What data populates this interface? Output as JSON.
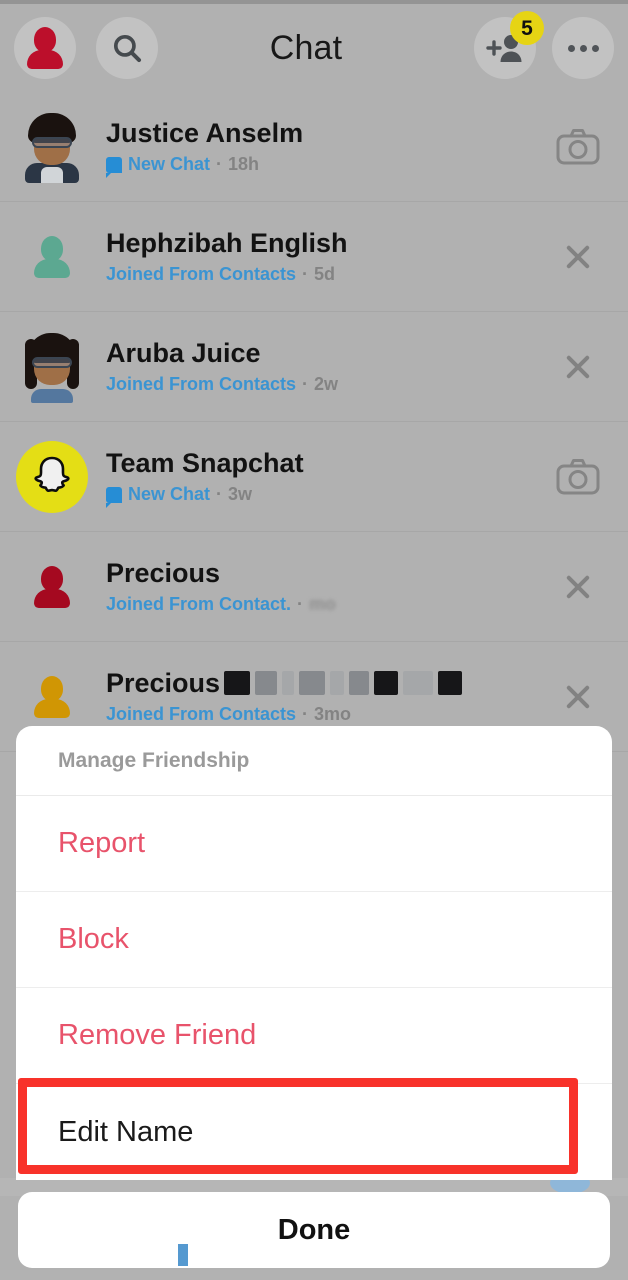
{
  "colors": {
    "background": "#bdbdbd",
    "accent_blue": "#3f9ee0",
    "destructive_red": "#e8536b",
    "highlight_red": "#f8322a",
    "snapchat_yellow": "#f3ec17",
    "badge_yellow": "#f5e216"
  },
  "header": {
    "title": "Chat",
    "profile_icon": "profile-avatar-icon",
    "search_icon": "search-icon",
    "add_friend_icon": "add-friend-icon",
    "add_friend_badge": "5",
    "more_icon": "more-options-icon"
  },
  "chat_list": [
    {
      "name": "Justice Anselm",
      "status": "New Chat",
      "time": "18h",
      "separator": "·",
      "has_chat_icon": true,
      "action_icon": "camera-icon",
      "avatar": "bitmoji-male-glasses"
    },
    {
      "name": "Hephzibah English",
      "status": "Joined From Contacts",
      "time": "5d",
      "separator": "·",
      "has_chat_icon": false,
      "action_icon": "close-icon",
      "avatar": "silhouette-teal"
    },
    {
      "name": "Aruba Juice",
      "status": "Joined From Contacts",
      "time": "2w",
      "separator": "·",
      "has_chat_icon": false,
      "action_icon": "close-icon",
      "avatar": "bitmoji-female-glasses"
    },
    {
      "name": "Team Snapchat",
      "status": "New Chat",
      "time": "3w",
      "separator": "·",
      "has_chat_icon": true,
      "action_icon": "camera-icon",
      "avatar": "snapchat-ghost"
    },
    {
      "name": "Precious",
      "status": "Joined From Contact.",
      "time": "mo",
      "separator": "·",
      "has_chat_icon": false,
      "action_icon": "close-icon",
      "avatar": "silhouette-dark-red",
      "time_blurred": true
    },
    {
      "name": "Precious",
      "name_redacted": true,
      "status": "Joined From Contacts",
      "time": "3mo",
      "separator": "·",
      "has_chat_icon": false,
      "action_icon": "close-icon",
      "avatar": "silhouette-gold"
    }
  ],
  "action_sheet": {
    "header": "Manage Friendship",
    "items": [
      {
        "label": "Report",
        "style": "destructive"
      },
      {
        "label": "Block",
        "style": "destructive"
      },
      {
        "label": "Remove Friend",
        "style": "destructive"
      },
      {
        "label": "Edit Name",
        "style": "neutral",
        "highlighted": true
      }
    ]
  },
  "done_button": {
    "label": "Done"
  }
}
